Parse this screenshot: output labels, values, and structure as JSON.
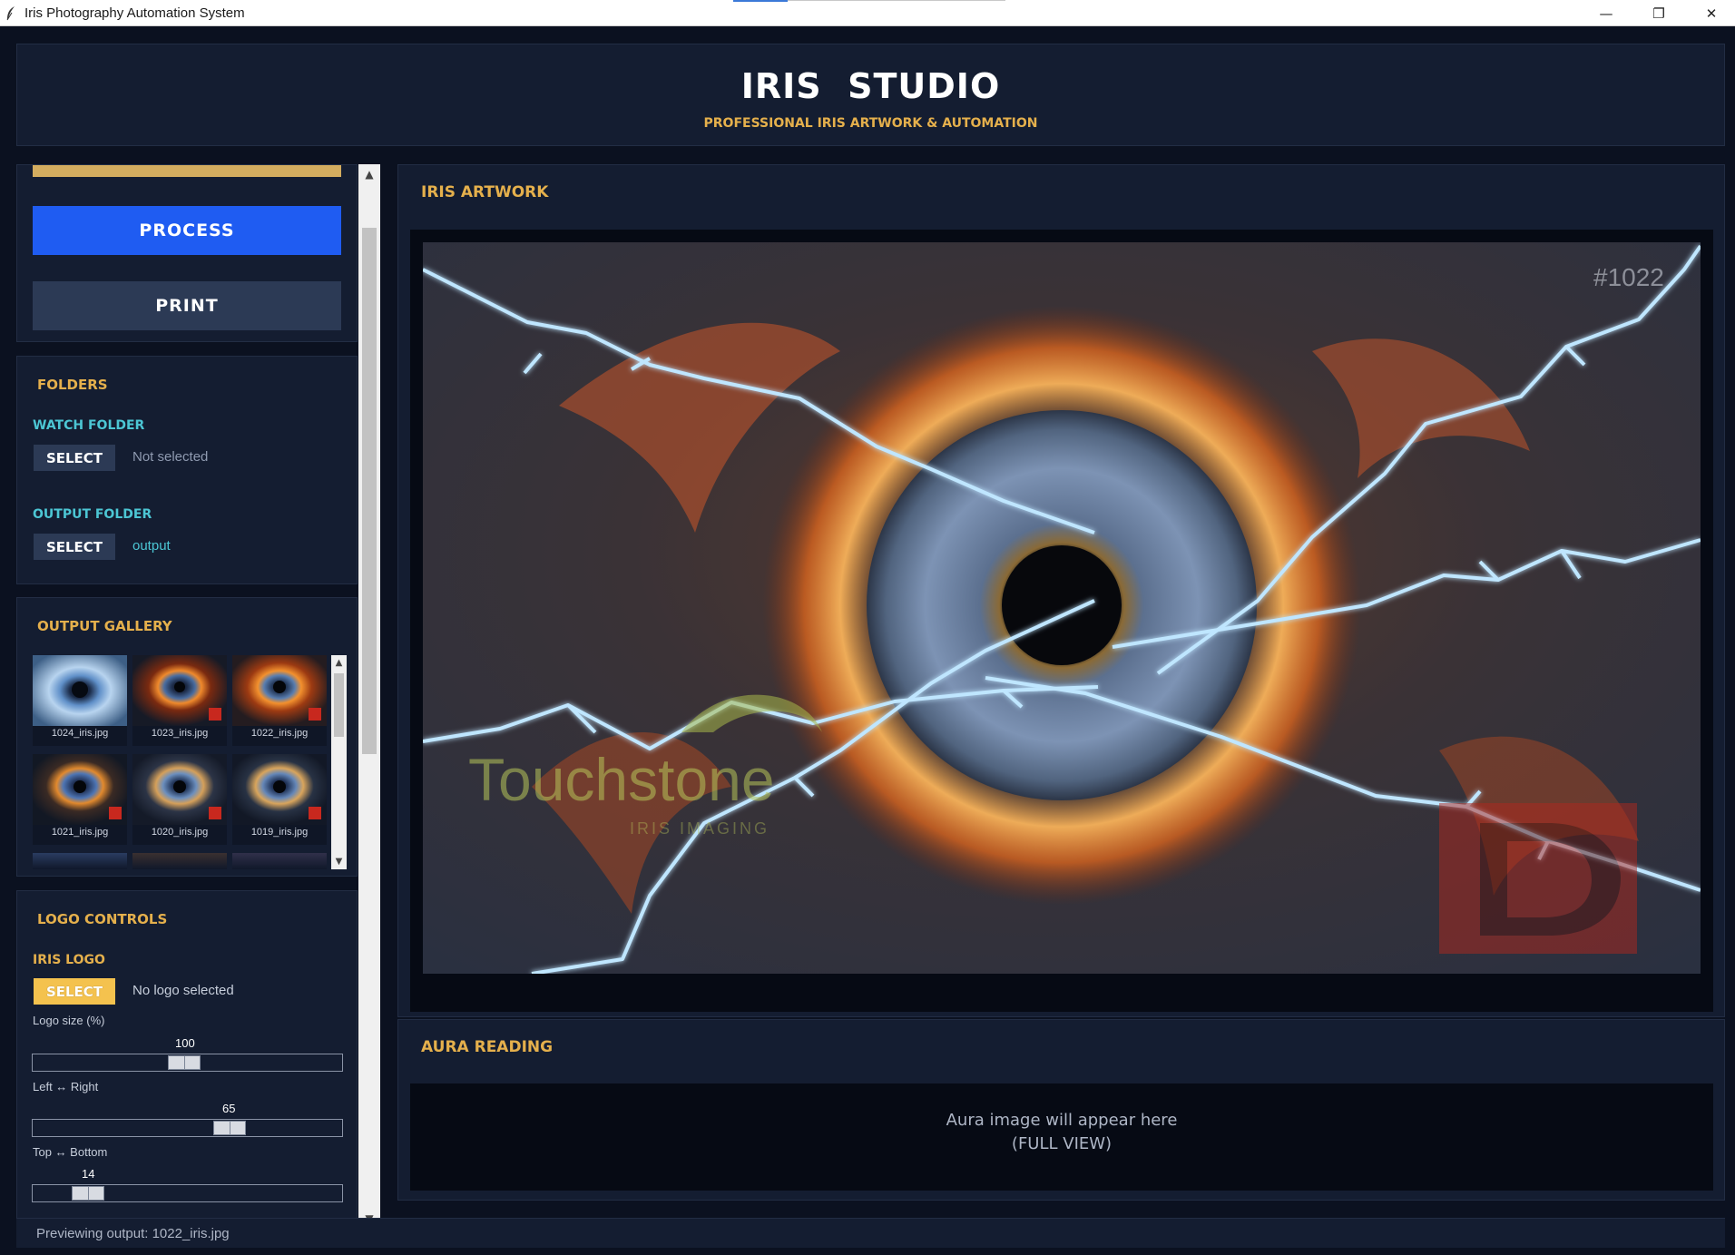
{
  "window": {
    "title": "Iris Photography Automation System",
    "minimize": "—",
    "maximize": "❐",
    "close": "✕"
  },
  "header": {
    "title": "IRIS  STUDIO",
    "subtitle": "PROFESSIONAL IRIS ARTWORK & AUTOMATION"
  },
  "actions": {
    "process_label": "PROCESS",
    "print_label": "PRINT"
  },
  "folders": {
    "title": "FOLDERS",
    "watch_label": "WATCH FOLDER",
    "watch_button": "SELECT",
    "watch_value": "Not selected",
    "output_label": "OUTPUT FOLDER",
    "output_button": "SELECT",
    "output_value": "output"
  },
  "gallery": {
    "title": "OUTPUT GALLERY",
    "items": [
      {
        "filename": "1024_iris.jpg",
        "style": "ice"
      },
      {
        "filename": "1023_iris.jpg",
        "style": "fire"
      },
      {
        "filename": "1022_iris.jpg",
        "style": "fire"
      },
      {
        "filename": "1021_iris.jpg",
        "style": "fire"
      },
      {
        "filename": "1020_iris.jpg",
        "style": "gold"
      },
      {
        "filename": "1019_iris.jpg",
        "style": "gold"
      }
    ]
  },
  "logo_controls": {
    "title": "LOGO CONTROLS",
    "iris_logo_label": "IRIS LOGO",
    "select_button": "SELECT",
    "logo_value": "No logo selected",
    "size_label": "Logo size (%)",
    "size_value": 100,
    "lr_label": "Left  ↔  Right",
    "lr_value": 65,
    "tb_label": "Top  ↔  Bottom",
    "tb_value": 14
  },
  "artwork": {
    "title": "IRIS ARTWORK",
    "number_badge": "#1022",
    "watermark_brand": "Touchstone",
    "watermark_tagline": "IRIS IMAGING"
  },
  "aura": {
    "title": "AURA READING",
    "placeholder_line1": "Aura image will appear here",
    "placeholder_line2": "(FULL VIEW)"
  },
  "status": {
    "text": "Previewing output: 1022_iris.jpg"
  },
  "colors": {
    "accent_gold": "#e5b04c",
    "accent_teal": "#4cc6d4",
    "process_blue": "#1f5cf2",
    "panel_bg": "#141d31"
  }
}
